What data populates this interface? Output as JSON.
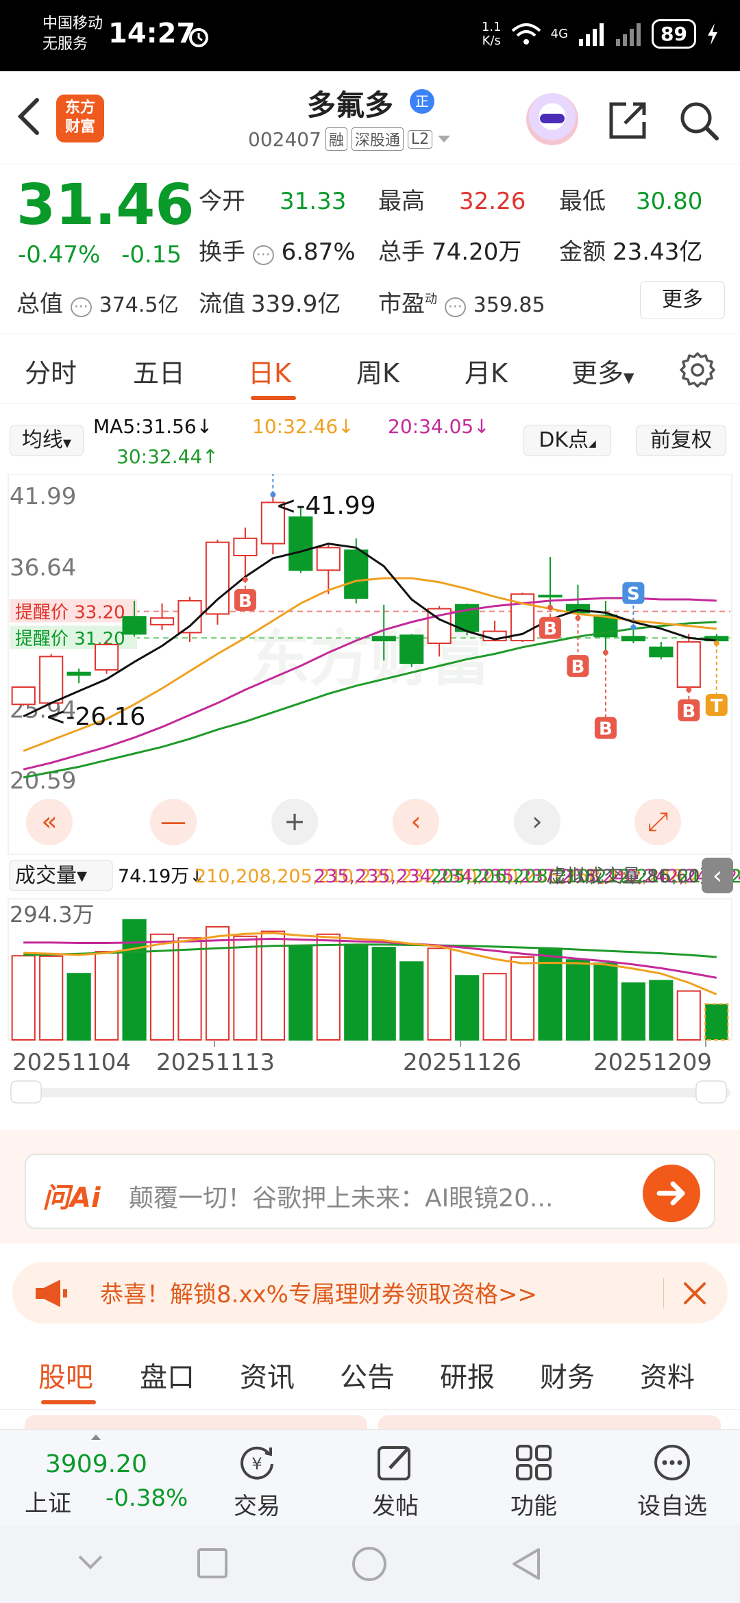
{
  "status_bar": {
    "carrier_line1": "中国移动",
    "carrier_line2": "无服务",
    "time": "14:27",
    "net_speed_top": "1.1",
    "net_speed_bottom": "K/s",
    "network": "4G",
    "battery": "89"
  },
  "header": {
    "logo_line1": "东方",
    "logo_line2": "财富",
    "stock_name": "多氟多",
    "name_badge": "正",
    "code": "002407",
    "tags": [
      "融",
      "深股通",
      "L2"
    ]
  },
  "quote": {
    "price": "31.46",
    "change_pct": "-0.47%",
    "change_amt": "-0.15",
    "open_label": "今开",
    "open_value": "31.33",
    "high_label": "最高",
    "high_value": "32.26",
    "low_label": "最低",
    "low_value": "30.80",
    "turnover_label": "换手",
    "turnover_value": "6.87%",
    "volume_label": "总手",
    "volume_value": "74.20万",
    "amount_label": "金额",
    "amount_value": "23.43亿",
    "total_cap_label": "总值",
    "total_cap_value": "374.5亿",
    "float_cap_label": "流值",
    "float_cap_value": "339.9亿",
    "pe_label": "市盈",
    "pe_sup": "动",
    "pe_value": "359.85",
    "more_label": "更多"
  },
  "period_tabs": [
    "分时",
    "五日",
    "日K",
    "周K",
    "月K",
    "更多"
  ],
  "period_active": "日K",
  "ma_legend": {
    "select_label": "均线",
    "ma5": "MA5:31.56↓",
    "ma10": "10:32.46↓",
    "ma20": "20:34.05↓",
    "ma30": "30:32.44↑",
    "dk_label": "DK点",
    "adjust_label": "前复权"
  },
  "colors": {
    "up": "#e0332d",
    "down": "#0a9a2a",
    "ma5": "#111111",
    "ma10": "#f0a020",
    "ma20": "#c42a98",
    "ma30": "#1f9a2a",
    "accent": "#e8551f"
  },
  "chart_data": {
    "type": "candlestick",
    "y_ticks": [
      "41.99",
      "36.64",
      "31.29",
      "25.94",
      "20.59"
    ],
    "ylim": [
      20.59,
      41.99
    ],
    "max_annotation": "<-41.99",
    "min_annotation": "<-26.16",
    "alert_upper": "提醒价 33.20",
    "alert_lower": "提醒价 31.20",
    "alert_upper_value": 33.2,
    "alert_lower_value": 31.2,
    "x_labels": [
      "20251104",
      "20251113",
      "20251126",
      "20251209"
    ],
    "candles": [
      {
        "o": 26.2,
        "c": 27.5,
        "h": 27.5,
        "l": 26.1
      },
      {
        "o": 26.3,
        "c": 29.8,
        "h": 30.0,
        "l": 26.2
      },
      {
        "o": 28.6,
        "c": 28.4,
        "h": 28.9,
        "l": 27.8
      },
      {
        "o": 28.8,
        "c": 30.7,
        "h": 31.0,
        "l": 28.5
      },
      {
        "o": 32.8,
        "c": 31.5,
        "h": 34.0,
        "l": 31.3
      },
      {
        "o": 32.2,
        "c": 32.7,
        "h": 33.8,
        "l": 31.8
      },
      {
        "o": 31.6,
        "c": 34.0,
        "h": 34.3,
        "l": 30.9
      },
      {
        "o": 33.0,
        "c": 38.4,
        "h": 38.6,
        "l": 32.2
      },
      {
        "o": 37.4,
        "c": 38.7,
        "h": 39.5,
        "l": 35.6
      },
      {
        "o": 38.3,
        "c": 41.4,
        "h": 41.99,
        "l": 37.5
      },
      {
        "o": 40.3,
        "c": 36.3,
        "h": 41.1,
        "l": 36.1
      },
      {
        "o": 36.3,
        "c": 38.0,
        "h": 38.2,
        "l": 34.5
      },
      {
        "o": 37.8,
        "c": 34.2,
        "h": 38.7,
        "l": 33.8
      },
      {
        "o": 31.3,
        "c": 31.0,
        "h": 33.7,
        "l": 29.5
      },
      {
        "o": 31.4,
        "c": 29.3,
        "h": 31.5,
        "l": 29.0
      },
      {
        "o": 30.8,
        "c": 33.4,
        "h": 33.6,
        "l": 29.8
      },
      {
        "o": 33.7,
        "c": 31.7,
        "h": 33.8,
        "l": 31.4
      },
      {
        "o": 31.0,
        "c": 31.7,
        "h": 32.5,
        "l": 31.0
      },
      {
        "o": 31.0,
        "c": 34.5,
        "h": 34.6,
        "l": 30.9
      },
      {
        "o": 34.4,
        "c": 34.3,
        "h": 37.3,
        "l": 33.5
      },
      {
        "o": 33.7,
        "c": 33.1,
        "h": 35.2,
        "l": 32.7
      },
      {
        "o": 32.9,
        "c": 31.3,
        "h": 34.0,
        "l": 30.1
      },
      {
        "o": 31.3,
        "c": 31.0,
        "h": 32.0,
        "l": 30.8
      },
      {
        "o": 30.5,
        "c": 29.8,
        "h": 30.9,
        "l": 29.6
      },
      {
        "o": 27.5,
        "c": 30.9,
        "h": 31.5,
        "l": 27.3
      },
      {
        "o": 31.3,
        "c": 31.0,
        "h": 31.5,
        "l": 30.8
      }
    ],
    "ma5": [
      25.3,
      26.3,
      27.2,
      28.1,
      29.4,
      30.6,
      32.1,
      34.1,
      35.8,
      37.2,
      37.7,
      38.3,
      38.0,
      36.6,
      34.1,
      32.6,
      31.7,
      31.1,
      31.5,
      32.6,
      33.3,
      33.1,
      32.4,
      31.9,
      31.2,
      31.0
    ],
    "ma10": [
      22.7,
      23.5,
      24.3,
      25.1,
      26.2,
      27.4,
      28.7,
      30.0,
      31.2,
      32.5,
      33.8,
      34.8,
      35.5,
      35.7,
      35.7,
      35.4,
      34.9,
      34.3,
      33.8,
      33.4,
      33.0,
      32.8,
      32.5,
      32.3,
      32.1,
      31.9
    ],
    "ma20": [
      21.3,
      21.8,
      22.4,
      23.0,
      23.7,
      24.5,
      25.4,
      26.3,
      27.3,
      28.2,
      29.1,
      30.1,
      31.0,
      31.8,
      32.4,
      32.9,
      33.3,
      33.6,
      33.8,
      34.0,
      34.1,
      34.2,
      34.2,
      34.1,
      34.1,
      34.0
    ],
    "ma30": [
      20.7,
      21.1,
      21.5,
      22.0,
      22.5,
      23.0,
      23.6,
      24.3,
      24.9,
      25.6,
      26.3,
      27.0,
      27.6,
      28.1,
      28.6,
      29.1,
      29.6,
      30.0,
      30.5,
      30.9,
      31.3,
      31.6,
      31.9,
      32.1,
      32.3,
      32.4
    ],
    "signals": [
      {
        "type": "B",
        "index": 8
      },
      {
        "type": "S",
        "index": 9
      },
      {
        "type": "S",
        "index": 22
      },
      {
        "type": "B",
        "index": 19
      },
      {
        "type": "B",
        "index": 20
      },
      {
        "type": "B",
        "index": 21
      },
      {
        "type": "B",
        "index": 24
      },
      {
        "type": "T",
        "index": 25
      }
    ],
    "volume": {
      "select_label": "成交量",
      "current": "74.19万↓",
      "ma1": [
        210,
        208,
        205,
        210,
        220,
        232,
        240,
        250,
        256,
        258,
        252,
        248,
        244,
        240,
        232,
        226,
        210,
        195,
        185,
        186,
        185,
        182,
        172,
        160,
        138,
        110
      ],
      "ma2": [
        235,
        235,
        234,
        234,
        235,
        237,
        238,
        240,
        242,
        244,
        242,
        240,
        238,
        236,
        232,
        228,
        222,
        215,
        208,
        202,
        196,
        190,
        182,
        173,
        162,
        150
      ],
      "ma3": [
        205,
        206,
        208,
        210,
        212,
        215,
        218,
        221,
        224,
        227,
        228,
        229,
        230,
        230,
        229,
        228,
        227,
        225,
        223,
        221,
        218,
        215,
        212,
        209,
        205,
        200
      ],
      "virtual": "虚拟成交量:86.60万",
      "y_top": "294.3万",
      "ymax": 294.3,
      "bars": [
        203,
        202,
        160,
        213,
        290,
        255,
        246,
        273,
        250,
        262,
        226,
        255,
        230,
        223,
        188,
        221,
        155,
        160,
        200,
        221,
        193,
        185,
        137,
        143,
        118,
        86.6
      ]
    }
  },
  "ai_bar": {
    "logo": "问Ai",
    "placeholder": "颠覆一切！谷歌押上未来：AI眼镜20..."
  },
  "promo": {
    "text": "恭喜！解锁8.xx%专属理财券领取资格>>"
  },
  "section_tabs": [
    "股吧",
    "盘口",
    "资讯",
    "公告",
    "研报",
    "财务",
    "资料"
  ],
  "section_active": "股吧",
  "bottom_nav": {
    "index_value": "3909.20",
    "index_name": "上证",
    "index_change": "-0.38%",
    "items": [
      "交易",
      "发帖",
      "功能",
      "设自选"
    ]
  }
}
